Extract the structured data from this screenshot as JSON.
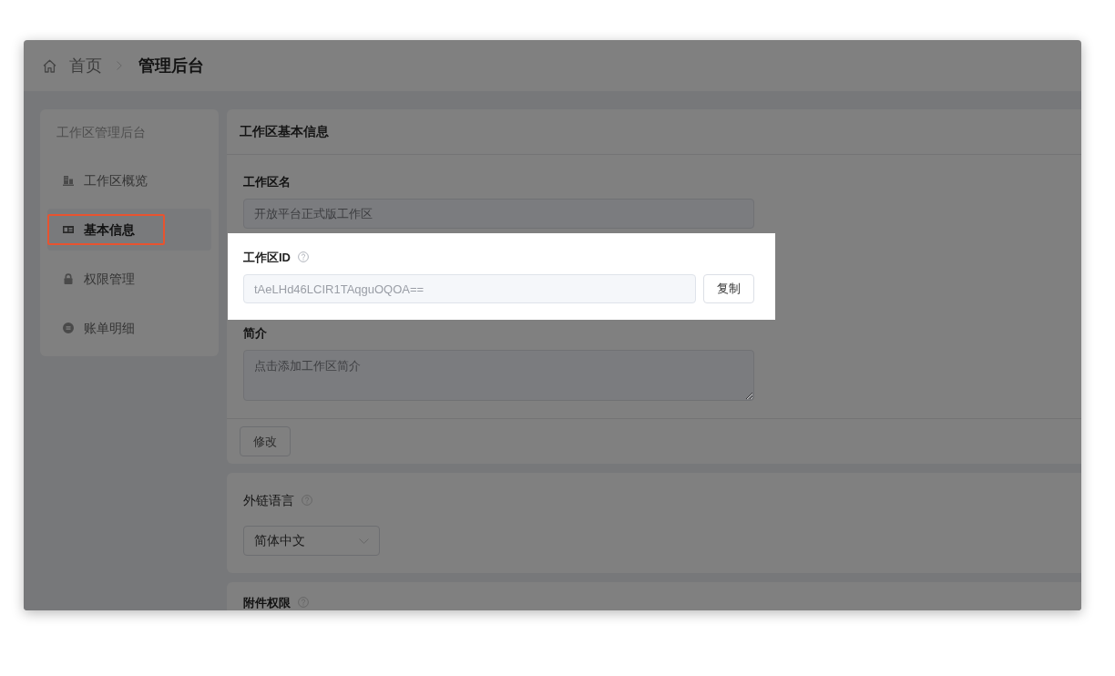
{
  "breadcrumb": [
    {
      "label": "首页",
      "current": false
    },
    {
      "label": "管理后台",
      "current": true
    }
  ],
  "sidebar": {
    "title": "工作区管理后台",
    "items": [
      {
        "label": "工作区概览",
        "selected": false,
        "outlined": false
      },
      {
        "label": "基本信息",
        "selected": true,
        "outlined": true
      },
      {
        "label": "权限管理",
        "selected": false,
        "outlined": false
      },
      {
        "label": "账单明细",
        "selected": false,
        "outlined": false
      }
    ]
  },
  "sections": [
    {
      "title": "工作区基本信息",
      "fields": [
        {
          "kind": "text",
          "label": "工作区名",
          "help": false,
          "value": "开放平台正式版工作区",
          "disabled": true,
          "spotlit": false
        },
        {
          "kind": "copy",
          "label": "工作区ID",
          "help": true,
          "value": "tAeLHd46LCIR1TAqguOQOA==",
          "disabled": true,
          "button": "复制",
          "spotlit": true
        },
        {
          "kind": "textarea",
          "label": "简介",
          "help": false,
          "placeholder": "点击添加工作区简介",
          "spotlit": false
        }
      ],
      "footer_button": "修改"
    },
    {
      "fields": [
        {
          "kind": "select",
          "label": "外链语言",
          "help": true,
          "value": "简体中文",
          "spotlit": false
        }
      ]
    },
    {
      "fields": [
        {
          "kind": "label",
          "label": "附件权限",
          "help": true,
          "spotlit": false
        }
      ]
    }
  ]
}
